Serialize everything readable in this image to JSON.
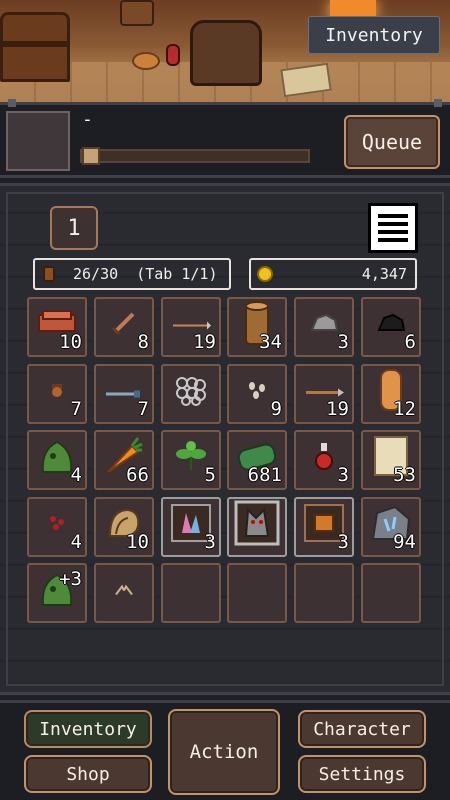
{
  "banner": {
    "label": "Inventory"
  },
  "queue": {
    "current_task": "-",
    "button_label": "Queue",
    "progress": 0
  },
  "inventory": {
    "tab_number": "1",
    "capacity_text": "26/30  (Tab 1/1)",
    "gold": "4,347",
    "slots": [
      {
        "item": "brick-icon",
        "qty": "10"
      },
      {
        "item": "sword-icon",
        "qty": "8"
      },
      {
        "item": "arrow-icon",
        "qty": "19"
      },
      {
        "item": "log-icon",
        "qty": "34"
      },
      {
        "item": "stone-icon",
        "qty": "3"
      },
      {
        "item": "coal-icon",
        "qty": "6"
      },
      {
        "item": "acorn-icon",
        "qty": "7"
      },
      {
        "item": "blade-icon",
        "qty": "7"
      },
      {
        "item": "chainmail-icon",
        "qty": ""
      },
      {
        "item": "seeds-icon",
        "qty": "9"
      },
      {
        "item": "bolt-icon",
        "qty": "19"
      },
      {
        "item": "plank-icon",
        "qty": "12"
      },
      {
        "item": "slime-icon",
        "qty": "4"
      },
      {
        "item": "carrot-icon",
        "qty": "66"
      },
      {
        "item": "herb-icon",
        "qty": "5"
      },
      {
        "item": "cloth-icon",
        "qty": "681"
      },
      {
        "item": "potion-icon",
        "qty": "3"
      },
      {
        "item": "scroll-icon",
        "qty": "53"
      },
      {
        "item": "berries-icon",
        "qty": "4"
      },
      {
        "item": "shell-icon",
        "qty": "10"
      },
      {
        "item": "crystal-card-icon",
        "qty": "3"
      },
      {
        "item": "wolf-card-icon",
        "qty": ""
      },
      {
        "item": "ore-card-icon",
        "qty": "3"
      },
      {
        "item": "rune-stone-icon",
        "qty": "94"
      },
      {
        "item": "slime-upgraded-icon",
        "qty": "+3"
      },
      {
        "item": "wings-icon",
        "qty": ""
      },
      {
        "item": "empty",
        "qty": ""
      },
      {
        "item": "empty",
        "qty": ""
      },
      {
        "item": "empty",
        "qty": ""
      },
      {
        "item": "empty",
        "qty": ""
      }
    ]
  },
  "nav": {
    "inventory": "Inventory",
    "shop": "Shop",
    "action": "Action",
    "character": "Character",
    "settings": "Settings"
  }
}
